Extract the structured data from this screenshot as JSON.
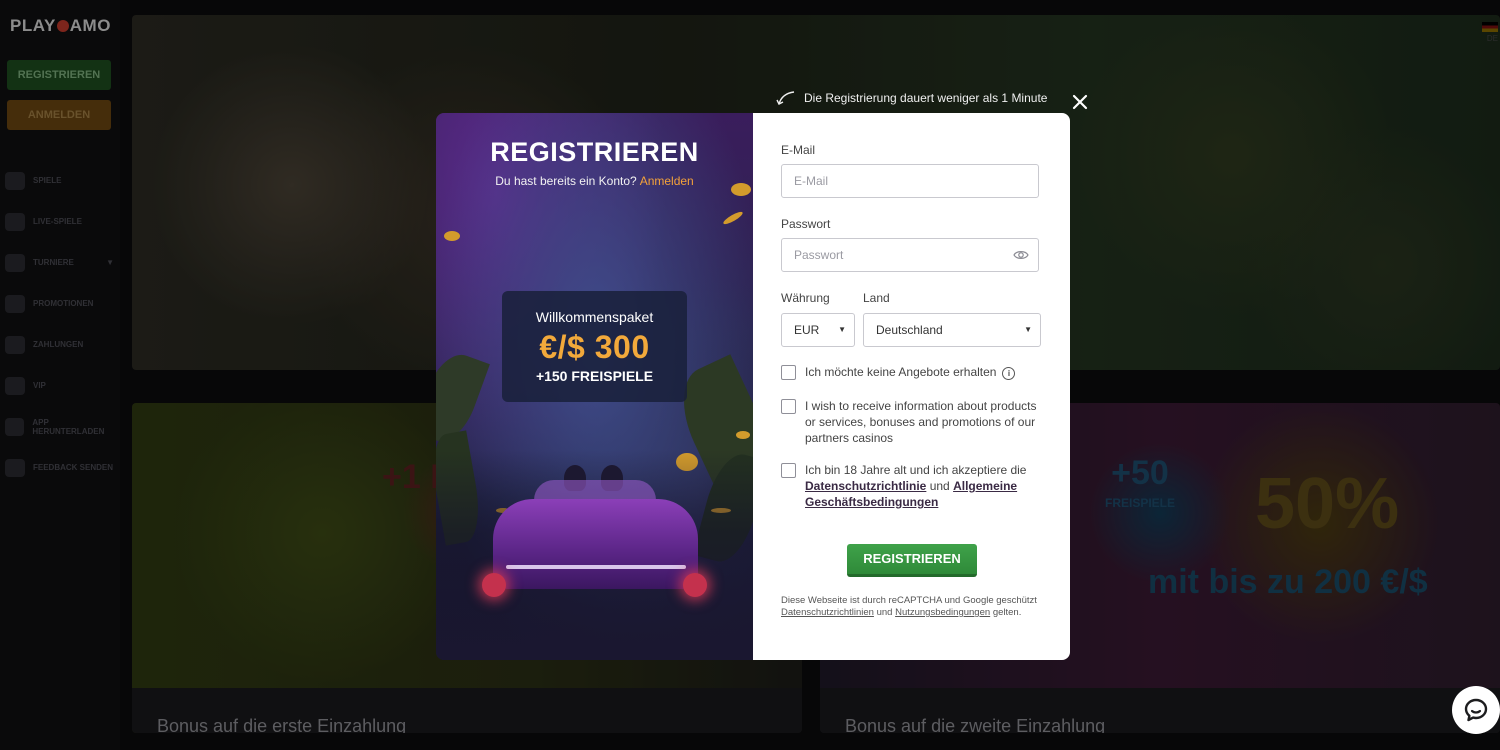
{
  "site": {
    "logo": "PLAY AMO",
    "logo_parts": [
      "PLAY",
      "AMO"
    ],
    "register_btn": "REGISTRIEREN",
    "login_btn": "ANMELDEN",
    "nav": [
      {
        "label": "SPIELE"
      },
      {
        "label": "LIVE-SPIELE"
      },
      {
        "label": "TURNIERE",
        "has_caret": true
      },
      {
        "label": "PROMOTIONEN"
      },
      {
        "label": "ZAHLUNGEN"
      },
      {
        "label": "VIP"
      },
      {
        "label": "APP HERUNTERLADEN"
      },
      {
        "label": "FEEDBACK SENDEN"
      }
    ],
    "lang": "DE",
    "cards": [
      {
        "title": "Bonus auf die erste Einzahlung",
        "promo": "+1 FREI"
      },
      {
        "title": "Bonus auf die zweite Einzahlung",
        "promo_fs": "+50",
        "promo_fs_sub": "FREISPIELE",
        "promo_pct": "50%",
        "promo_sub": "mit bis zu 200 €/$"
      }
    ]
  },
  "modal": {
    "hint": "Die Registrierung dauert weniger als 1 Minute",
    "promo": {
      "title": "REGISTRIEREN",
      "subtitle": "Du hast bereits ein Konto?",
      "login_link": "Anmelden",
      "welcome": "Willkommenspaket",
      "amount": "€/$ 300",
      "freespins": "+150 FREISPIELE"
    },
    "form": {
      "email_label": "E-Mail",
      "email_placeholder": "E-Mail",
      "password_label": "Passwort",
      "password_placeholder": "Passwort",
      "currency_label": "Währung",
      "currency_value": "EUR",
      "country_label": "Land",
      "country_value": "Deutschland",
      "cb_offers": "Ich möchte keine Angebote erhalten",
      "cb_info": "I wish to receive information about products or services, bonuses and promotions of our partners casinos",
      "cb_terms_pre": "Ich bin 18 Jahre alt und ich akzeptiere die",
      "cb_terms_privacy": "Datenschutzrichtlinie",
      "cb_terms_and": "und",
      "cb_terms_gtc": "Allgemeine Geschäftsbedingungen",
      "submit": "REGISTRIEREN",
      "recaptcha_pre": "Diese Webseite ist durch reCAPTCHA und Google geschützt",
      "recaptcha_privacy": "Datenschutzrichtlinien",
      "recaptcha_and": "und",
      "recaptcha_terms": "Nutzungsbedingungen",
      "recaptcha_post": "gelten."
    }
  },
  "colors": {
    "accent_orange": "#f2a93b",
    "submit_green": "#3fa24a",
    "chat_bg": "#ffffff"
  }
}
